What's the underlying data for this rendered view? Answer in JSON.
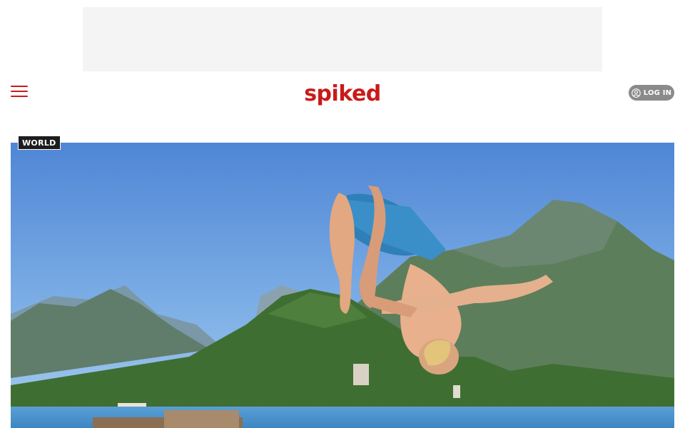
{
  "header": {
    "logo_text": "spiked",
    "login_label": "LOG IN"
  },
  "article": {
    "category": "WORLD"
  },
  "icons": {
    "menu": "hamburger-menu-icon",
    "login": "user-icon"
  },
  "colors": {
    "brand": "#c91a1a",
    "login_bg": "#8a8a8a",
    "tag_bg": "#1d1d1d"
  }
}
